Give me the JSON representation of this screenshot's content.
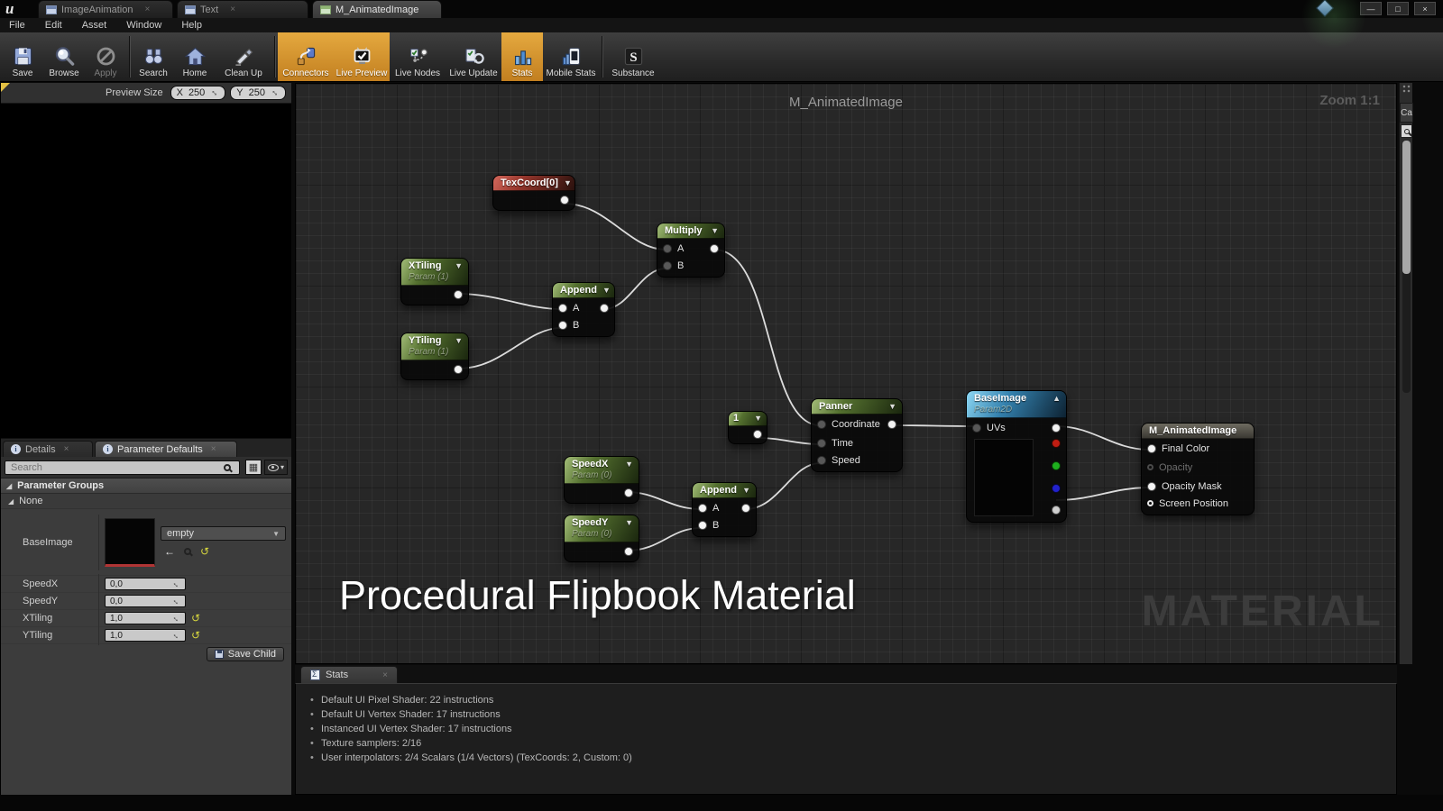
{
  "window": {
    "logo_glyph": "u",
    "tabs": [
      {
        "label": "ImageAnimation"
      },
      {
        "label": "Text"
      },
      {
        "label": "M_AnimatedImage"
      }
    ],
    "menu": [
      "File",
      "Edit",
      "Asset",
      "Window",
      "Help"
    ],
    "controls": {
      "minimize": "—",
      "maximize": "□",
      "close": "×"
    }
  },
  "toolbar": {
    "buttons": [
      {
        "label": "Save",
        "icon": "floppy-disk"
      },
      {
        "label": "Browse",
        "icon": "magnifier-sphere"
      },
      {
        "label": "Apply",
        "icon": "slashed-circle",
        "state": "disabled"
      },
      {
        "label": "Search",
        "icon": "binoculars"
      },
      {
        "label": "Home",
        "icon": "house"
      },
      {
        "label": "Clean Up",
        "icon": "sweep-brush"
      },
      {
        "label": "Connectors",
        "icon": "connector-arrow",
        "state": "active"
      },
      {
        "label": "Live Preview",
        "icon": "monitor-check",
        "state": "active"
      },
      {
        "label": "Live Nodes",
        "icon": "node-path"
      },
      {
        "label": "Live Update",
        "icon": "clipboard-refresh"
      },
      {
        "label": "Stats",
        "icon": "bar-chart",
        "state": "active"
      },
      {
        "label": "Mobile Stats",
        "icon": "phone-chart"
      },
      {
        "label": "Substance",
        "icon": "substance-s",
        "glyph": "S"
      }
    ]
  },
  "preview": {
    "label": "Preview Size",
    "x_label": "X",
    "x_value": "250",
    "y_label": "Y",
    "y_value": "250"
  },
  "details": {
    "tabs": [
      {
        "label": "Details"
      },
      {
        "label": "Parameter Defaults"
      }
    ],
    "search_placeholder": "Search",
    "group_header": "Parameter Groups",
    "group": "None",
    "params": [
      {
        "name": "BaseImage",
        "value": "empty"
      },
      {
        "name": "SpeedX",
        "value": "0,0"
      },
      {
        "name": "SpeedY",
        "value": "0,0"
      },
      {
        "name": "XTiling",
        "value": "1,0"
      },
      {
        "name": "YTiling",
        "value": "1,0"
      }
    ],
    "save_child_label": "Save Child"
  },
  "graph": {
    "title": "M_AnimatedImage",
    "zoom_label": "Zoom 1:1",
    "watermark": "MATERIAL",
    "caption": "Procedural Flipbook Material",
    "side_tab": "Ca",
    "nodes": {
      "texcoord": {
        "title": "TexCoord[0]"
      },
      "multiply": {
        "title": "Multiply",
        "in_a": "A",
        "in_b": "B"
      },
      "xtiling": {
        "title": "XTiling",
        "subtitle": "Param (1)"
      },
      "ytiling": {
        "title": "YTiling",
        "subtitle": "Param (1)"
      },
      "append1": {
        "title": "Append",
        "in_a": "A",
        "in_b": "B"
      },
      "speedx": {
        "title": "SpeedX",
        "subtitle": "Param (0)"
      },
      "speedy": {
        "title": "SpeedY",
        "subtitle": "Param (0)"
      },
      "append2": {
        "title": "Append",
        "in_a": "A",
        "in_b": "B"
      },
      "one": {
        "title": "1"
      },
      "panner": {
        "title": "Panner",
        "in_coordinate": "Coordinate",
        "in_time": "Time",
        "in_speed": "Speed"
      },
      "baseimage": {
        "title": "BaseImage",
        "subtitle": "Param2D",
        "in_uvs": "UVs"
      },
      "output": {
        "title": "M_AnimatedImage",
        "pin_final_color": "Final Color",
        "pin_opacity": "Opacity",
        "pin_opacity_mask": "Opacity Mask",
        "pin_screen_position": "Screen Position"
      }
    }
  },
  "stats_panel": {
    "tab": "Stats",
    "lines": [
      "Default UI Pixel Shader: 22 instructions",
      "Default UI Vertex Shader: 17 instructions",
      "Instanced UI Vertex Shader: 17 instructions",
      "Texture samplers: 2/16",
      "User interpolators: 2/4 Scalars (1/4 Vectors) (TexCoords: 2, Custom: 0)"
    ]
  }
}
